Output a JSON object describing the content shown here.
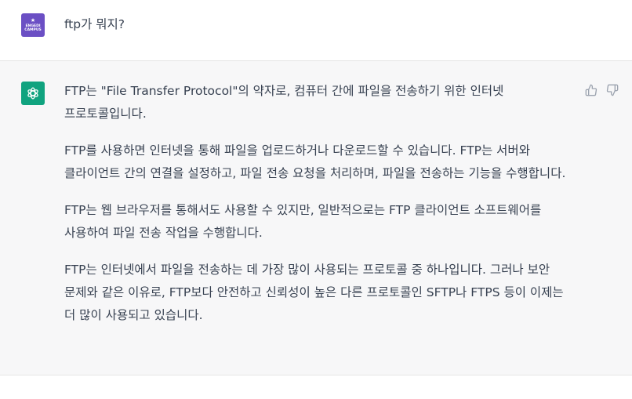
{
  "user": {
    "avatar_label_line1": "ENGEDI",
    "avatar_label_line2": "CAMPUS",
    "message": "ftp가 뭐지?"
  },
  "assistant": {
    "paragraphs": [
      "FTP는 \"File Transfer Protocol\"의 약자로, 컴퓨터 간에 파일을 전송하기 위한 인터넷 프로토콜입니다.",
      "FTP를 사용하면 인터넷을 통해 파일을 업로드하거나 다운로드할 수 있습니다. FTP는 서버와 클라이언트 간의 연결을 설정하고, 파일 전송 요청을 처리하며, 파일을 전송하는 기능을 수행합니다.",
      "FTP는 웹 브라우저를 통해서도 사용할 수 있지만, 일반적으로는 FTP 클라이언트 소프트웨어를 사용하여 파일 전송 작업을 수행합니다.",
      "FTP는 인터넷에서 파일을 전송하는 데 가장 많이 사용되는 프로토콜 중 하나입니다. 그러나 보안 문제와 같은 이유로, FTP보다 안전하고 신뢰성이 높은 다른 프로토콜인 SFTP나 FTPS 등이 이제는 더 많이 사용되고 있습니다."
    ]
  },
  "icons": {
    "assistant_avatar": "openai-logo-icon",
    "feedback_up": "thumbs-up-icon",
    "feedback_down": "thumbs-down-icon"
  },
  "colors": {
    "user_avatar_bg": "#6b4fc4",
    "assistant_avatar_bg": "#10a37f",
    "assistant_row_bg": "#f7f7f8",
    "text": "#374151"
  }
}
